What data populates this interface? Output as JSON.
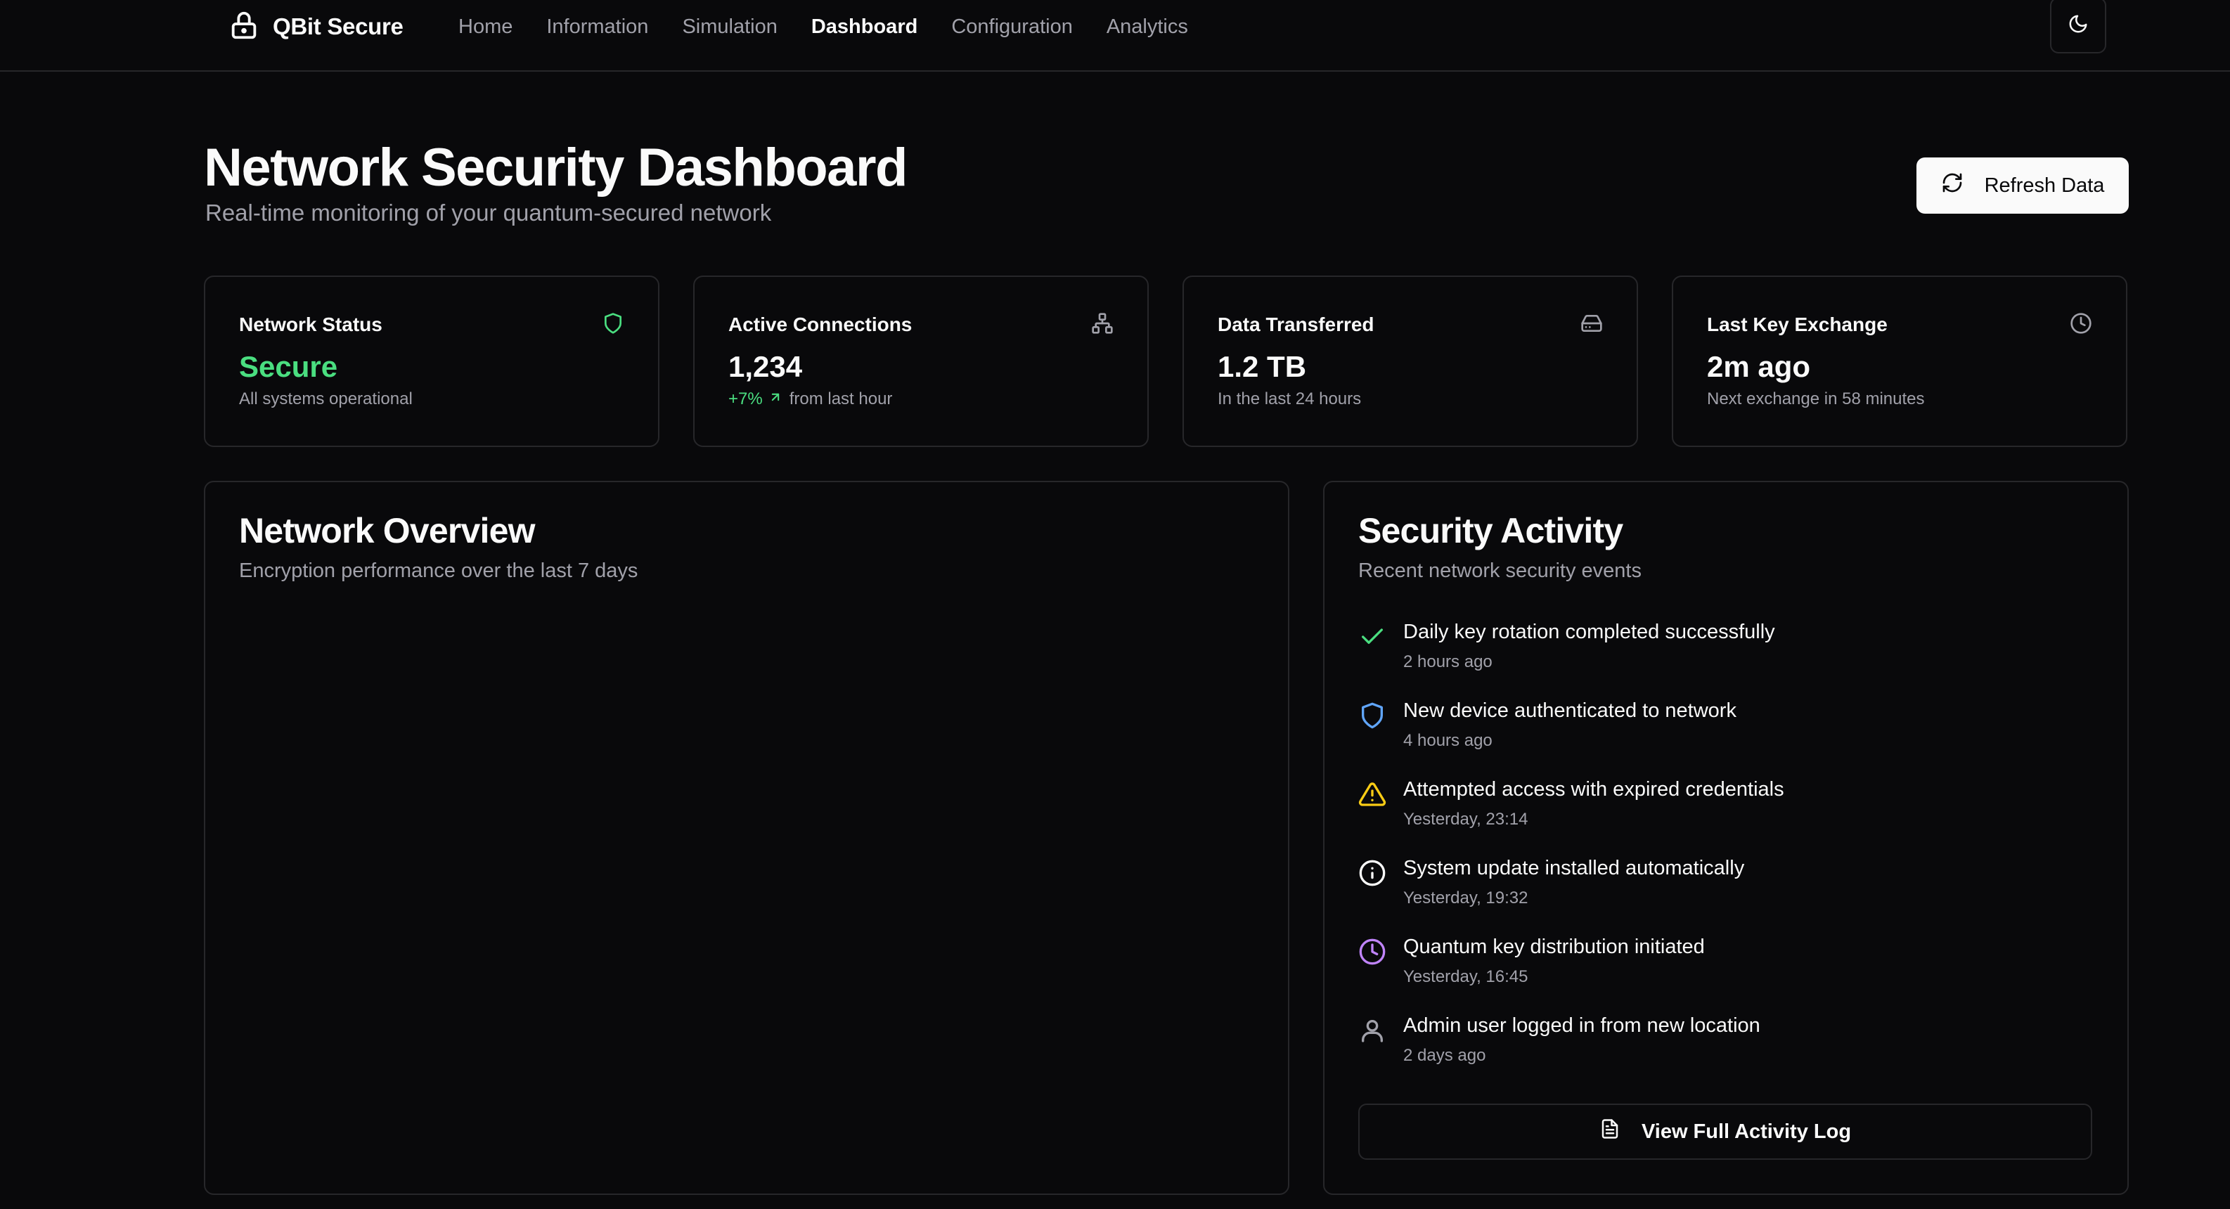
{
  "header": {
    "brand": "QBit Secure",
    "nav": [
      {
        "label": "Home",
        "active": false
      },
      {
        "label": "Information",
        "active": false
      },
      {
        "label": "Simulation",
        "active": false
      },
      {
        "label": "Dashboard",
        "active": true
      },
      {
        "label": "Configuration",
        "active": false
      },
      {
        "label": "Analytics",
        "active": false
      }
    ],
    "theme_icon": "moon-icon"
  },
  "page": {
    "title": "Network Security Dashboard",
    "subtitle": "Real-time monitoring of your quantum-secured network",
    "refresh_label": "Refresh Data"
  },
  "stats": [
    {
      "label": "Network Status",
      "value": "Secure",
      "sub": "All systems operational",
      "icon": "shield-icon"
    },
    {
      "label": "Active Connections",
      "value": "1,234",
      "trend": "+7%",
      "sub": "from last hour",
      "icon": "network-icon"
    },
    {
      "label": "Data Transferred",
      "value": "1.2 TB",
      "sub": "In the last 24 hours",
      "icon": "hard-drive-icon"
    },
    {
      "label": "Last Key Exchange",
      "value": "2m ago",
      "sub": "Next exchange in 58 minutes",
      "icon": "clock-icon"
    }
  ],
  "overview": {
    "title": "Network Overview",
    "subtitle": "Encryption performance over the last 7 days"
  },
  "activity": {
    "title": "Security Activity",
    "subtitle": "Recent network security events",
    "items": [
      {
        "text": "Daily key rotation completed successfully",
        "time": "2 hours ago",
        "icon": "check-icon"
      },
      {
        "text": "New device authenticated to network",
        "time": "4 hours ago",
        "icon": "shield-icon"
      },
      {
        "text": "Attempted access with expired credentials",
        "time": "Yesterday, 23:14",
        "icon": "warning-icon"
      },
      {
        "text": "System update installed automatically",
        "time": "Yesterday, 19:32",
        "icon": "info-icon"
      },
      {
        "text": "Quantum key distribution initiated",
        "time": "Yesterday, 16:45",
        "icon": "clock-icon"
      },
      {
        "text": "Admin user logged in from new location",
        "time": "2 days ago",
        "icon": "user-icon"
      }
    ],
    "log_button": "View Full Activity Log"
  },
  "colors": {
    "background": "#09090b",
    "border": "#27272a",
    "muted_text": "#a1a1aa",
    "success": "#4ade80",
    "info_blue": "#60a5fa",
    "warning": "#facc15",
    "purple": "#c084fc"
  }
}
